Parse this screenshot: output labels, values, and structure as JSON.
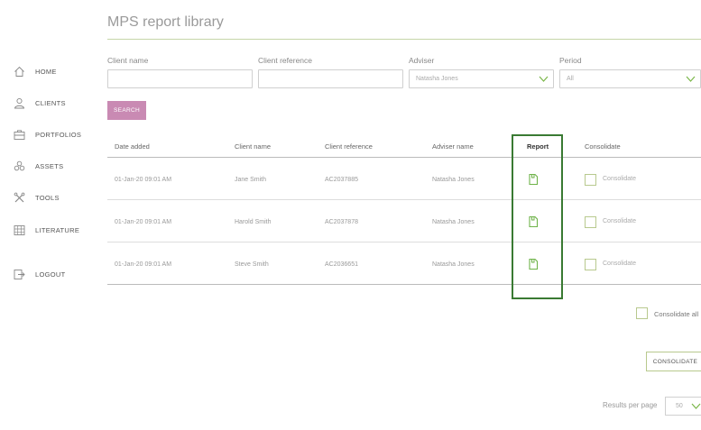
{
  "page_title": "MPS report library",
  "nav": {
    "home": "HOME",
    "clients": "CLIENTS",
    "portfolios": "PORTFOLIOS",
    "assets": "ASSETS",
    "tools": "TOOLS",
    "literature": "LITERATURE",
    "logout": "LOGOUT"
  },
  "filters": {
    "client_name_label": "Client name",
    "client_name_value": "",
    "client_ref_label": "Client reference",
    "client_ref_value": "",
    "adviser_label": "Adviser",
    "adviser_value": "Natasha Jones",
    "period_label": "Period",
    "period_value": "All"
  },
  "search_label": "SEARCH",
  "table": {
    "headers": {
      "date": "Date added",
      "client": "Client name",
      "ref": "Client reference",
      "adviser": "Adviser name",
      "report": "Report",
      "consolidate": "Consolidate"
    },
    "rows": [
      {
        "date": "01-Jan-20 09:01 AM",
        "client": "Jane Smith",
        "ref": "AC2037885",
        "adviser": "Natasha Jones",
        "consolidate": "Consolidate"
      },
      {
        "date": "01-Jan-20 09:01 AM",
        "client": "Harold Smith",
        "ref": "AC2037878",
        "adviser": "Natasha Jones",
        "consolidate": "Consolidate"
      },
      {
        "date": "01-Jan-20 09:01 AM",
        "client": "Steve Smith",
        "ref": "AC2036651",
        "adviser": "Natasha Jones",
        "consolidate": "Consolidate"
      }
    ]
  },
  "consolidate_all_label": "Consolidate all",
  "consolidate_button": "CONSOLIDATE",
  "results_per_page_label": "Results per page",
  "results_per_page_value": "50",
  "colors": {
    "accent_pink": "#c98ab3",
    "accent_green": "#3a7a33",
    "icon_green": "#6fb34a",
    "rule_green": "#c5d6a8"
  },
  "icons": {
    "home": "home-icon",
    "clients": "user-icon",
    "portfolios": "briefcase-icon",
    "assets": "coins-icon",
    "tools": "tools-icon",
    "literature": "book-grid-icon",
    "logout": "logout-icon",
    "report": "document-icon",
    "dropdown": "chevron-down-icon"
  }
}
